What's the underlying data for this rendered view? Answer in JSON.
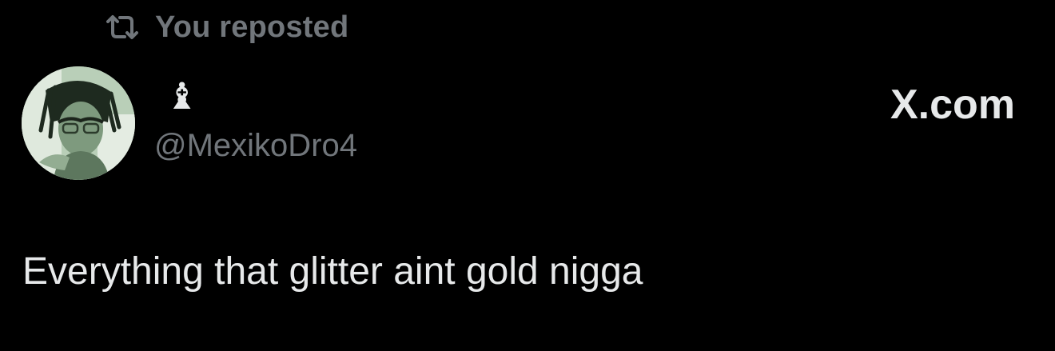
{
  "repost": {
    "icon": "repost-icon",
    "label": "You reposted"
  },
  "author": {
    "avatar": "avatar-photo",
    "display_name": "♝",
    "handle": "@MexikoDro4"
  },
  "brand": {
    "label": "X.com"
  },
  "tweet": {
    "text": "Everything that glitter aint gold nigga"
  },
  "colors": {
    "background": "#000000",
    "primary_text": "#e7e9ea",
    "secondary_text": "#71767b"
  }
}
